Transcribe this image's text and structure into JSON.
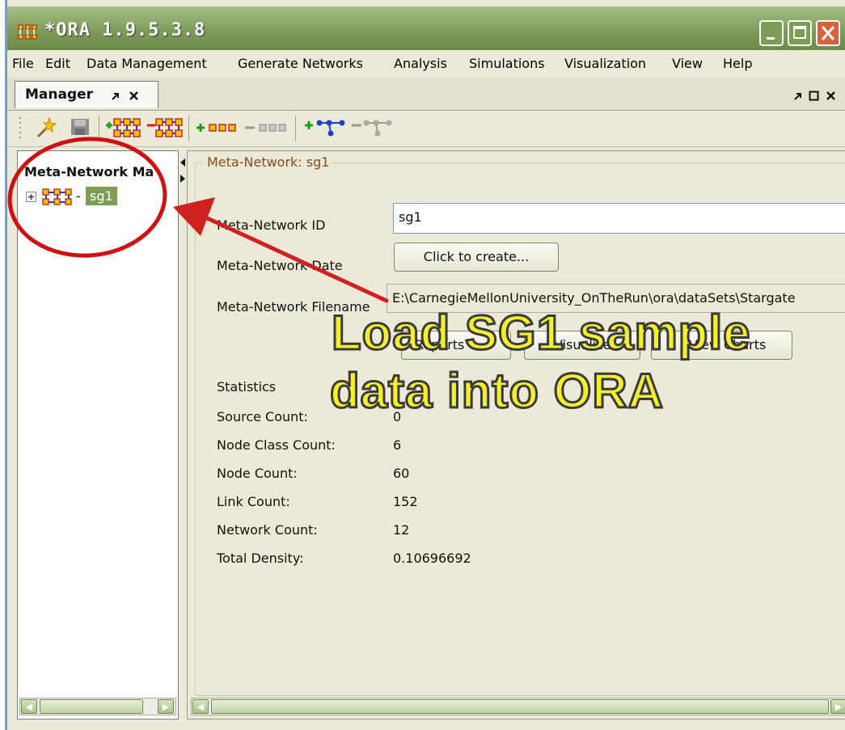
{
  "window": {
    "title": "*ORA 1.9.5.3.8"
  },
  "menu": [
    "File",
    "Edit",
    "Data Management",
    "Generate Networks",
    "Analysis",
    "Simulations",
    "Visualization",
    "View",
    "Help"
  ],
  "tab": {
    "label": "Manager"
  },
  "tree": {
    "header": "Meta-Network Ma",
    "node_label": "sg1"
  },
  "details": {
    "legend": "Meta-Network: sg1",
    "id_label": "Meta-Network ID",
    "id_value": "sg1",
    "date_label": "Meta-Network Date",
    "date_button": "Click to create...",
    "filename_label": "Meta-Network Filename",
    "filename_value": "E:\\CarnegieMellonUniversity_OnTheRun\\ora\\dataSets\\Stargate",
    "buttons": [
      "Reports",
      "Visualize",
      "View Charts"
    ],
    "stats_heading": "Statistics",
    "stats": [
      {
        "label": "Source Count:",
        "value": "0"
      },
      {
        "label": "Node Class Count:",
        "value": "6"
      },
      {
        "label": "Node Count:",
        "value": "60"
      },
      {
        "label": "Link Count:",
        "value": "152"
      },
      {
        "label": "Network Count:",
        "value": "12"
      },
      {
        "label": "Total Density:",
        "value": "0.10696692"
      }
    ]
  },
  "annotation": {
    "line1": "Load SG1 sample",
    "line2": "data into ORA",
    "circle_color": "#d01010",
    "arrow_color": "#d02020",
    "text_color": "#f4ef2a"
  }
}
